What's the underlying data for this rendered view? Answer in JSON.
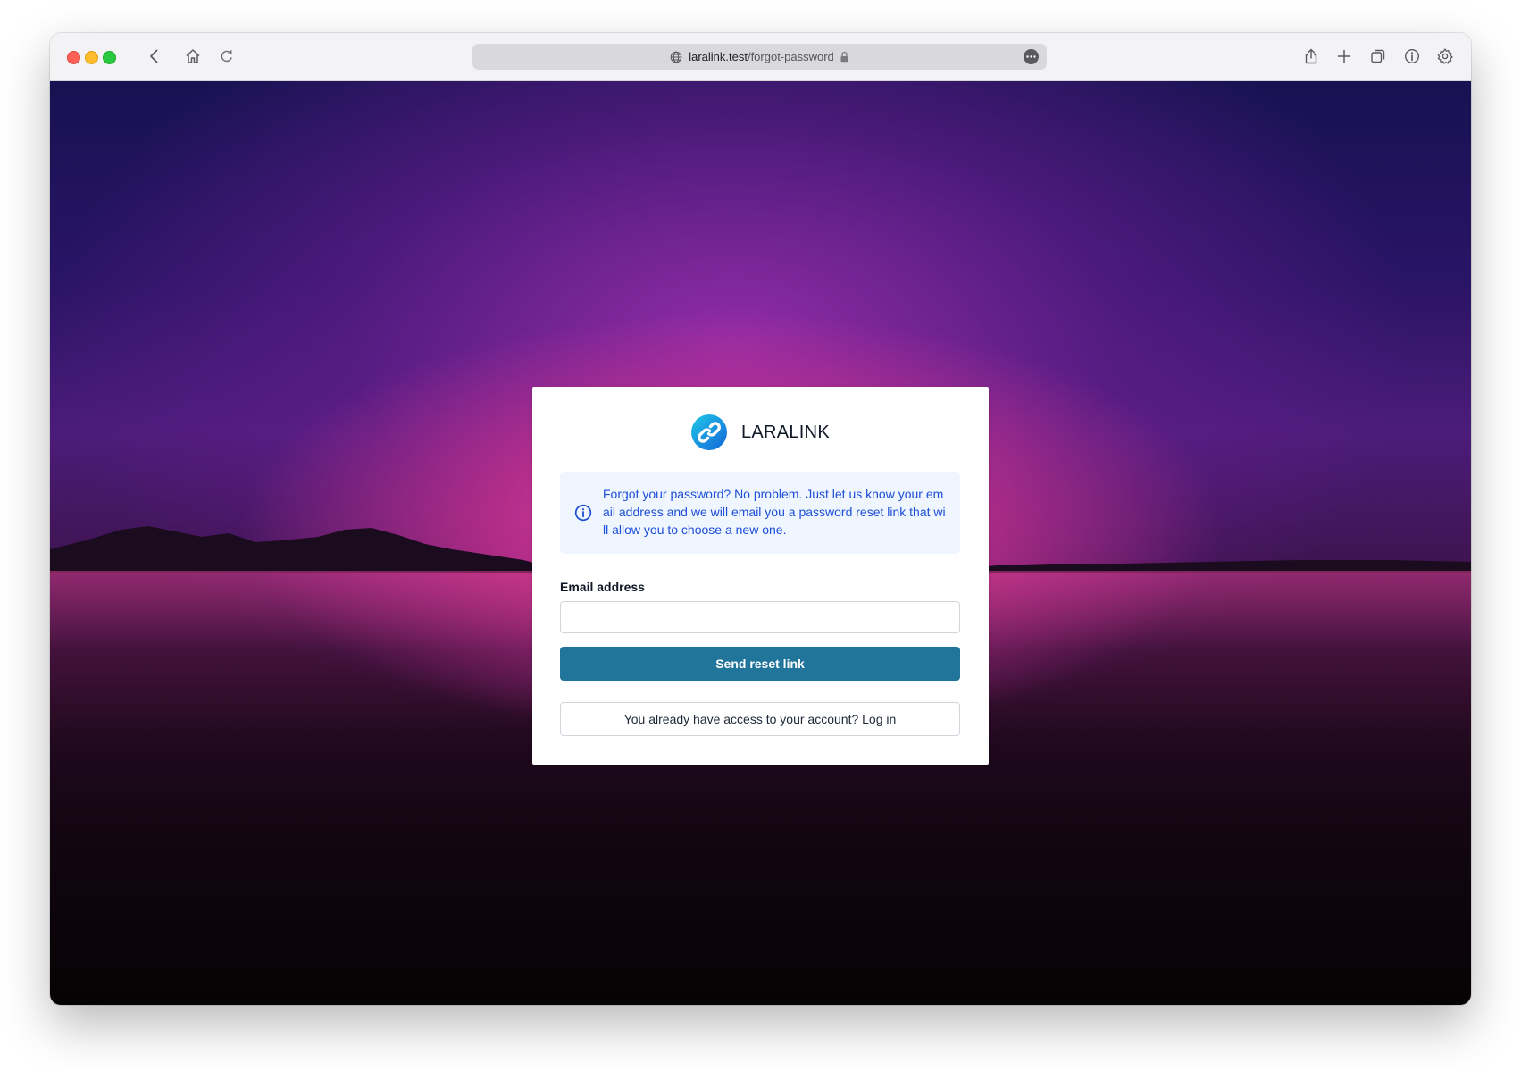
{
  "browser": {
    "url_host": "laralink.test",
    "url_path": "/forgot-password",
    "toolbar_icons": [
      "back-icon",
      "home-icon",
      "reload-icon",
      "share-icon",
      "new-tab-icon",
      "tabs-overview-icon",
      "info-icon",
      "settings-icon"
    ]
  },
  "brand": {
    "name": "LARALINK",
    "logo_colors": [
      "#1ec8e6",
      "#1565d8"
    ]
  },
  "alert": {
    "icon": "info-circle-icon",
    "message": "Forgot your password? No problem. Just let us know your email address and we will email you a password reset link that will allow you to choose a new one."
  },
  "form": {
    "email_label": "Email address",
    "email_value": "",
    "submit_label": "Send reset link",
    "login_link": "You already have access to your account? Log in"
  },
  "colors": {
    "primary_button": "#21759b",
    "alert_bg": "#eff6ff",
    "alert_text": "#1d4ed8"
  }
}
